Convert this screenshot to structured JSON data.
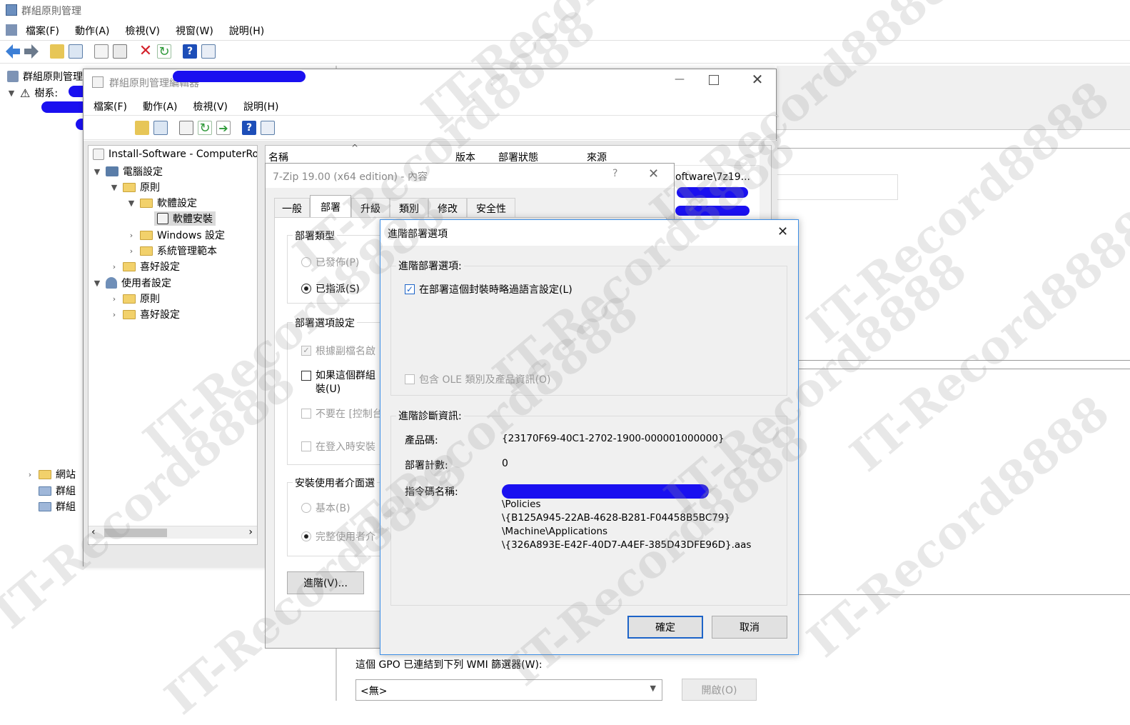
{
  "main_window": {
    "title": "群組原則管理",
    "menu": [
      "檔案(F)",
      "動作(A)",
      "檢視(V)",
      "視窗(W)",
      "說明(H)"
    ],
    "tree": [
      {
        "label": "群組原則管理"
      },
      {
        "label": "樹系:"
      },
      {
        "label": "網站"
      },
      {
        "label": "群組"
      },
      {
        "label": "群組"
      }
    ],
    "wmi_label": "這個 GPO 已連結到下列 WMI 篩選器(W):",
    "wmi_value": "<無>",
    "open_button": "開啟(O)"
  },
  "editor_window": {
    "title": "群組原則管理編輯器",
    "menu": [
      "檔案(F)",
      "動作(A)",
      "檢視(V)",
      "說明(H)"
    ],
    "tree": {
      "root": "Install-Software - ComputerRo",
      "computer_config": "電腦設定",
      "policies": "原則",
      "software_settings": "軟體設定",
      "software_install": "軟體安裝",
      "windows_settings": "Windows 設定",
      "admin_templates": "系統管理範本",
      "preferences": "喜好設定",
      "user_config": "使用者設定",
      "user_policies": "原則",
      "user_preferences": "喜好設定"
    },
    "columns": [
      "名稱",
      "版本",
      "部署狀態",
      "來源"
    ],
    "source_cell": "oftware\\7z19..."
  },
  "props_dialog": {
    "title": "7-Zip 19.00 (x64 edition) - 內容",
    "help": "?",
    "tabs": [
      "一般",
      "部署",
      "升級",
      "類別",
      "修改",
      "安全性"
    ],
    "deploy_type_label": "部署類型",
    "published": "已發佈(P)",
    "assigned": "已指派(S)",
    "deploy_options_label": "部署選項設定",
    "opt1": "根據副檔名啟",
    "opt2_line1": "如果這個群組",
    "opt2_line2": "裝(U)",
    "opt3": "不要在 [控制台",
    "opt4": "在登入時安裝",
    "ui_label": "安裝使用者介面選",
    "basic": "基本(B)",
    "full": "完整使用者介",
    "advanced_button": "進階(V)..."
  },
  "adv_dialog": {
    "title": "進階部署選項",
    "group1_label": "進階部署選項:",
    "ignore_lang": "在部署這個封裝時略過語言設定(L)",
    "include_ole": "包含 OLE 類別及產品資訊(O)",
    "group2_label": "進階診斷資訊:",
    "product_code_label": "產品碼:",
    "product_code": "{23170F69-40C1-2702-1900-000001000000}",
    "deploy_count_label": "部署計數:",
    "deploy_count": "0",
    "script_name_label": "指令碼名稱:",
    "script_lines": [
      "\\Policies",
      "\\{B125A945-22AB-4628-B281-F04458B5BC79}",
      "\\Machine\\Applications",
      "\\{326A893E-E42F-40D7-A4EF-385D43DFE96D}.aas"
    ],
    "ok": "確定",
    "cancel": "取消"
  },
  "watermark": "IT-Record8888"
}
